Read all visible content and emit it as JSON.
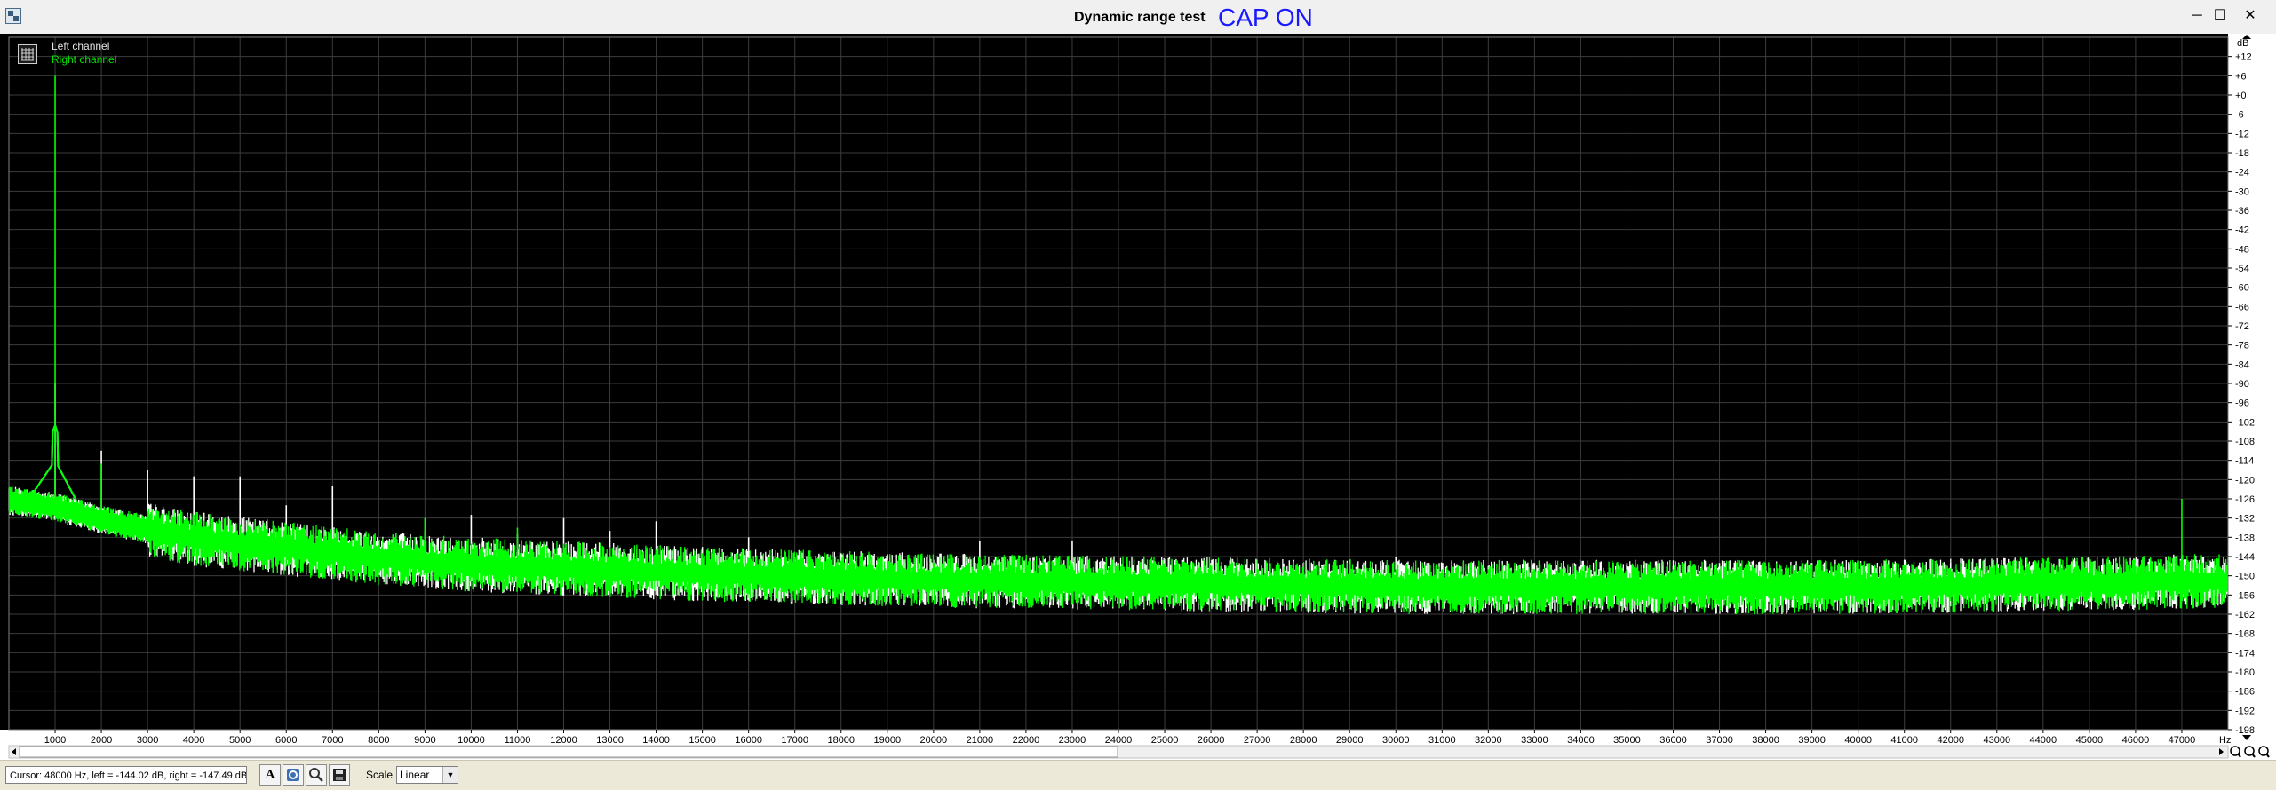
{
  "window": {
    "title": "Dynamic range test",
    "annotation": "CAP ON",
    "minimize_glyph": "─",
    "maximize_glyph": "☐",
    "close_glyph": "✕"
  },
  "legend": {
    "left_channel": "Left channel",
    "right_channel": "Right channel"
  },
  "statusbar": {
    "cursor_text": "Cursor:  48000 Hz,  left = -144.02 dB,  right = -147.49 dB",
    "scale_label": "Scale",
    "scale_value": "Linear",
    "text_button_glyph": "A"
  },
  "colors": {
    "background": "#000000",
    "grid": "#3c3c3c",
    "left_channel": "#ffffff",
    "right_channel": "#00ff00",
    "annotation": "#1a1aff"
  },
  "chart_data": {
    "type": "line",
    "x_unit": "Hz",
    "y_unit": "dB",
    "xlim": [
      0,
      48000
    ],
    "ylim": [
      -198,
      18
    ],
    "x_ticks": [
      1000,
      2000,
      3000,
      4000,
      5000,
      6000,
      7000,
      8000,
      9000,
      10000,
      11000,
      12000,
      13000,
      14000,
      15000,
      16000,
      17000,
      18000,
      19000,
      20000,
      21000,
      22000,
      23000,
      24000,
      25000,
      26000,
      27000,
      28000,
      29000,
      30000,
      31000,
      32000,
      33000,
      34000,
      35000,
      36000,
      37000,
      38000,
      39000,
      40000,
      41000,
      42000,
      43000,
      44000,
      45000,
      46000,
      47000
    ],
    "y_ticks": [
      12,
      6,
      0,
      -6,
      -12,
      -18,
      -24,
      -30,
      -36,
      -42,
      -48,
      -54,
      -60,
      -66,
      -72,
      -78,
      -84,
      -90,
      -96,
      -102,
      -108,
      -114,
      -120,
      -126,
      -132,
      -138,
      -144,
      -150,
      -156,
      -162,
      -168,
      -174,
      -180,
      -186,
      -192,
      -198
    ],
    "y_tick_labels": [
      "+12",
      "+6",
      "+0",
      "-6",
      "-12",
      "-18",
      "-24",
      "-30",
      "-36",
      "-42",
      "-48",
      "-54",
      "-60",
      "-66",
      "-72",
      "-78",
      "-84",
      "-90",
      "-96",
      "-102",
      "-108",
      "-114",
      "-120",
      "-126",
      "-132",
      "-138",
      "-144",
      "-150",
      "-156",
      "-162",
      "-168",
      "-174",
      "-180",
      "-186",
      "-192",
      "-198"
    ],
    "grid": true,
    "legend_position": "top-left",
    "series": [
      {
        "name": "Left channel",
        "color": "#ffffff",
        "noise_floor": [
          [
            0,
            -126
          ],
          [
            1000,
            -128
          ],
          [
            2000,
            -132
          ],
          [
            4000,
            -138
          ],
          [
            6000,
            -141
          ],
          [
            8000,
            -144
          ],
          [
            10000,
            -146
          ],
          [
            15000,
            -149
          ],
          [
            20000,
            -151
          ],
          [
            25000,
            -152
          ],
          [
            30000,
            -153
          ],
          [
            35000,
            -153
          ],
          [
            40000,
            -153
          ],
          [
            45000,
            -152
          ],
          [
            48000,
            -151
          ]
        ],
        "peaks": [
          [
            1000,
            -90
          ],
          [
            2000,
            -111
          ],
          [
            3000,
            -117
          ],
          [
            4000,
            -119
          ],
          [
            5000,
            -119
          ],
          [
            6000,
            -128
          ],
          [
            7000,
            -122
          ],
          [
            8000,
            -139
          ],
          [
            9000,
            -136
          ],
          [
            10000,
            -131
          ],
          [
            11000,
            -137
          ],
          [
            12000,
            -132
          ],
          [
            13000,
            -136
          ],
          [
            14000,
            -133
          ],
          [
            15000,
            -141
          ],
          [
            16000,
            -138
          ],
          [
            17000,
            -144
          ],
          [
            18000,
            -143
          ],
          [
            19000,
            -144
          ],
          [
            20000,
            -145
          ],
          [
            21000,
            -139
          ],
          [
            22000,
            -145
          ],
          [
            23000,
            -139
          ],
          [
            24000,
            -146
          ],
          [
            25000,
            -147
          ],
          [
            26000,
            -146
          ],
          [
            27000,
            -146
          ],
          [
            28000,
            -146
          ],
          [
            29000,
            -145
          ],
          [
            30000,
            -144
          ],
          [
            31000,
            -146
          ],
          [
            32000,
            -147
          ],
          [
            33000,
            -146
          ],
          [
            34000,
            -147
          ],
          [
            35000,
            -146
          ],
          [
            36000,
            -147
          ],
          [
            37000,
            -146
          ],
          [
            38000,
            -147
          ],
          [
            39000,
            -146
          ],
          [
            40000,
            -147
          ],
          [
            41000,
            -145
          ],
          [
            42000,
            -146
          ],
          [
            43000,
            -146
          ],
          [
            44000,
            -146
          ],
          [
            45000,
            -147
          ],
          [
            46000,
            -146
          ],
          [
            47000,
            -144
          ]
        ]
      },
      {
        "name": "Right channel",
        "color": "#00ff00",
        "noise_floor": [
          [
            0,
            -126
          ],
          [
            1000,
            -128
          ],
          [
            2000,
            -132
          ],
          [
            4000,
            -138
          ],
          [
            6000,
            -141
          ],
          [
            8000,
            -144
          ],
          [
            10000,
            -146
          ],
          [
            15000,
            -149
          ],
          [
            20000,
            -151
          ],
          [
            25000,
            -152
          ],
          [
            30000,
            -153
          ],
          [
            35000,
            -153
          ],
          [
            40000,
            -153
          ],
          [
            45000,
            -152
          ],
          [
            48000,
            -151
          ]
        ],
        "peaks": [
          [
            1000,
            6
          ],
          [
            2000,
            -115
          ],
          [
            3000,
            -130
          ],
          [
            4000,
            -131
          ],
          [
            5000,
            -134
          ],
          [
            6000,
            -135
          ],
          [
            7000,
            -142
          ],
          [
            8000,
            -142
          ],
          [
            9000,
            -132
          ],
          [
            10000,
            -140
          ],
          [
            11000,
            -135
          ],
          [
            12000,
            -140
          ],
          [
            13000,
            -141
          ],
          [
            14000,
            -142
          ],
          [
            15000,
            -143
          ],
          [
            16000,
            -145
          ],
          [
            17000,
            -145
          ],
          [
            18000,
            -146
          ],
          [
            19000,
            -147
          ],
          [
            20000,
            -146
          ],
          [
            21000,
            -144
          ],
          [
            22000,
            -147
          ],
          [
            23000,
            -146
          ],
          [
            24000,
            -148
          ],
          [
            25000,
            -148
          ],
          [
            26000,
            -147
          ],
          [
            27000,
            -148
          ],
          [
            28000,
            -148
          ],
          [
            29000,
            -148
          ],
          [
            30000,
            -148
          ],
          [
            31000,
            -148
          ],
          [
            32000,
            -148
          ],
          [
            33000,
            -148
          ],
          [
            34000,
            -148
          ],
          [
            35000,
            -148
          ],
          [
            36000,
            -148
          ],
          [
            37000,
            -148
          ],
          [
            38000,
            -148
          ],
          [
            39000,
            -148
          ],
          [
            40000,
            -148
          ],
          [
            41000,
            -147
          ],
          [
            42000,
            -148
          ],
          [
            43000,
            -146
          ],
          [
            44000,
            -147
          ],
          [
            45000,
            -147
          ],
          [
            46000,
            -147
          ],
          [
            47000,
            -126
          ]
        ]
      }
    ]
  }
}
